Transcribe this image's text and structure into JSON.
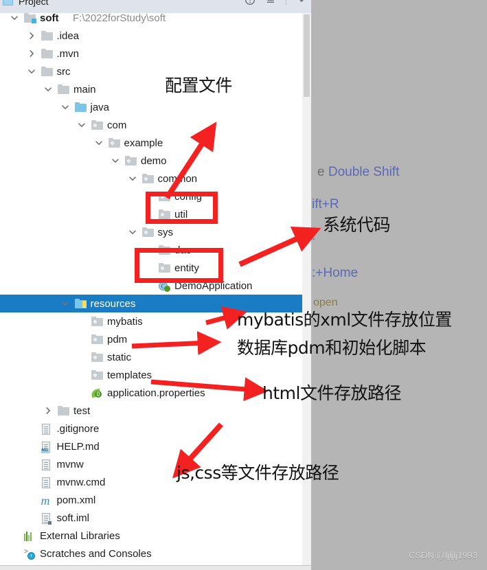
{
  "window": {
    "tool_window_title": "Project",
    "tool_window_icon": "project-view-icon",
    "toolbar_icons": [
      "help-icon",
      "collapse-all-icon",
      "hide-icon"
    ]
  },
  "tree": {
    "selected_row": "resources",
    "rows": [
      {
        "id": "soft",
        "label": "soft",
        "secondary": "F:\\2022forStudy\\soft",
        "indent": 0,
        "twisty": "down",
        "icon": "module-folder-icon",
        "bold": true
      },
      {
        "id": "idea",
        "label": ".idea",
        "secondary": "",
        "indent": 1,
        "twisty": "right",
        "icon": "folder-icon"
      },
      {
        "id": "mvn",
        "label": ".mvn",
        "secondary": "",
        "indent": 1,
        "twisty": "right",
        "icon": "folder-icon"
      },
      {
        "id": "src",
        "label": "src",
        "secondary": "",
        "indent": 1,
        "twisty": "down",
        "icon": "folder-icon"
      },
      {
        "id": "main",
        "label": "main",
        "secondary": "",
        "indent": 2,
        "twisty": "down",
        "icon": "folder-icon"
      },
      {
        "id": "java",
        "label": "java",
        "secondary": "",
        "indent": 3,
        "twisty": "down",
        "icon": "source-root-folder-icon"
      },
      {
        "id": "com",
        "label": "com",
        "secondary": "",
        "indent": 4,
        "twisty": "down",
        "icon": "package-icon"
      },
      {
        "id": "example",
        "label": "example",
        "secondary": "",
        "indent": 5,
        "twisty": "down",
        "icon": "package-icon"
      },
      {
        "id": "demo",
        "label": "demo",
        "secondary": "",
        "indent": 6,
        "twisty": "down",
        "icon": "package-icon"
      },
      {
        "id": "common",
        "label": "common",
        "secondary": "",
        "indent": 7,
        "twisty": "down",
        "icon": "package-icon"
      },
      {
        "id": "config",
        "label": "config",
        "secondary": "",
        "indent": 8,
        "twisty": "none",
        "icon": "package-icon"
      },
      {
        "id": "util",
        "label": "util",
        "secondary": "",
        "indent": 8,
        "twisty": "none",
        "icon": "package-icon"
      },
      {
        "id": "sys",
        "label": "sys",
        "secondary": "",
        "indent": 7,
        "twisty": "down",
        "icon": "package-icon"
      },
      {
        "id": "dao",
        "label": "dao",
        "secondary": "",
        "indent": 8,
        "twisty": "none",
        "icon": "package-icon"
      },
      {
        "id": "entity",
        "label": "entity",
        "secondary": "",
        "indent": 8,
        "twisty": "none",
        "icon": "package-icon"
      },
      {
        "id": "demoapplication",
        "label": "DemoApplication",
        "secondary": "",
        "indent": 8,
        "twisty": "none",
        "icon": "spring-boot-class-icon"
      },
      {
        "id": "resources",
        "label": "resources",
        "secondary": "",
        "indent": 3,
        "twisty": "down",
        "icon": "resource-root-folder-icon",
        "selected": true
      },
      {
        "id": "mybatis",
        "label": "mybatis",
        "secondary": "",
        "indent": 4,
        "twisty": "none",
        "icon": "package-icon"
      },
      {
        "id": "pdm",
        "label": "pdm",
        "secondary": "",
        "indent": 4,
        "twisty": "none",
        "icon": "package-icon"
      },
      {
        "id": "static",
        "label": "static",
        "secondary": "",
        "indent": 4,
        "twisty": "none",
        "icon": "package-icon"
      },
      {
        "id": "templates",
        "label": "templates",
        "secondary": "",
        "indent": 4,
        "twisty": "none",
        "icon": "package-icon"
      },
      {
        "id": "application.properties",
        "label": "application.properties",
        "secondary": "",
        "indent": 4,
        "twisty": "none",
        "icon": "spring-properties-icon"
      },
      {
        "id": "test",
        "label": "test",
        "secondary": "",
        "indent": 2,
        "twisty": "right",
        "icon": "folder-icon"
      },
      {
        "id": "gitignore",
        "label": ".gitignore",
        "secondary": "",
        "indent": 1,
        "twisty": "none",
        "icon": "text-file-icon"
      },
      {
        "id": "help.md",
        "label": "HELP.md",
        "secondary": "",
        "indent": 1,
        "twisty": "none",
        "icon": "markdown-file-icon"
      },
      {
        "id": "mvnw",
        "label": "mvnw",
        "secondary": "",
        "indent": 1,
        "twisty": "none",
        "icon": "text-file-icon"
      },
      {
        "id": "mvnw.cmd",
        "label": "mvnw.cmd",
        "secondary": "",
        "indent": 1,
        "twisty": "none",
        "icon": "text-file-icon"
      },
      {
        "id": "pom.xml",
        "label": "pom.xml",
        "secondary": "",
        "indent": 1,
        "twisty": "none",
        "icon": "maven-file-icon"
      },
      {
        "id": "soft.iml",
        "label": "soft.iml",
        "secondary": "",
        "indent": 1,
        "twisty": "none",
        "icon": "iml-file-icon"
      },
      {
        "id": "external-libraries",
        "label": "External Libraries",
        "secondary": "",
        "indent": 0,
        "twisty": "none",
        "icon": "libraries-icon"
      },
      {
        "id": "scratches",
        "label": "Scratches and Consoles",
        "secondary": "",
        "indent": 0,
        "twisty": "none",
        "icon": "scratches-icon"
      }
    ]
  },
  "tips_panel": {
    "lines": [
      {
        "prefix": "e ",
        "text": "Double Shift"
      },
      {
        "prefix": "",
        "text": "ift+R"
      },
      {
        "prefix": "",
        "text": ":"
      },
      {
        "prefix": "",
        "text": ":+Home"
      },
      {
        "prefix": "",
        "text": "open"
      }
    ]
  },
  "annotations": {
    "texts": [
      {
        "id": "config-files",
        "text": "配置文件"
      },
      {
        "id": "system-code",
        "text": "系统代码"
      },
      {
        "id": "mybatis-xml",
        "text": "mybatis的xml文件存放位置"
      },
      {
        "id": "db-pdm",
        "text": "数据库pdm和初始化脚本"
      },
      {
        "id": "html-path",
        "text": "html文件存放路径"
      },
      {
        "id": "js-css-path",
        "text": "js,css等文件存放路径"
      }
    ],
    "boxes": [
      {
        "id": "config-util-box",
        "targets": "config, util"
      },
      {
        "id": "dao-entity-box",
        "targets": "dao, entity"
      }
    ],
    "accent_color": "#f42121"
  },
  "watermark": {
    "text": "CSDN @ljljlj1993"
  }
}
